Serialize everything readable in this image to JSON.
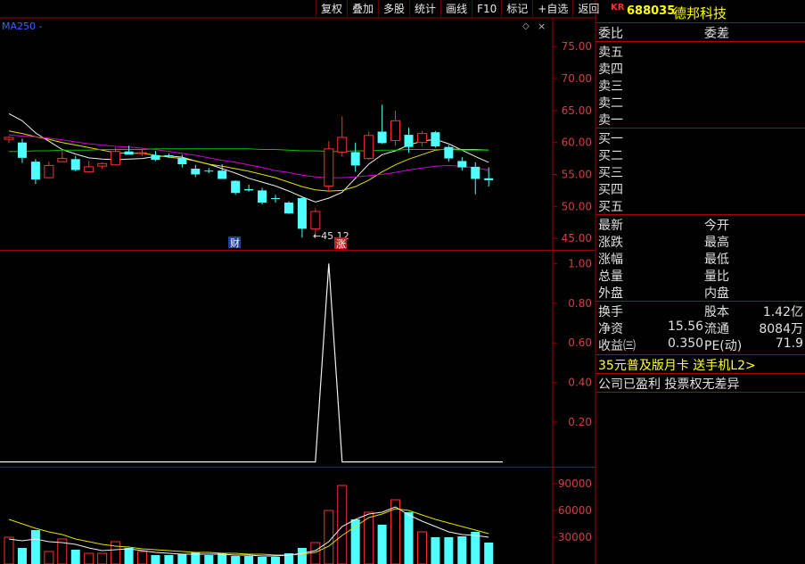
{
  "toolbar": {
    "buttons": [
      "复权",
      "叠加",
      "多股",
      "统计",
      "画线",
      "F10",
      "标记",
      "+自选",
      "返回"
    ]
  },
  "chart_overlay": {
    "ma_label": "MA250 -",
    "low_marker": "←45.12",
    "fin_badge": "财",
    "up_badge": "涨"
  },
  "header": {
    "market_tag": "KR",
    "code": "688035",
    "name": "德邦科技"
  },
  "quote": {
    "weibi_label": "委比",
    "weicha_label": "委差",
    "sell_levels": [
      "卖五",
      "卖四",
      "卖三",
      "卖二",
      "卖一"
    ],
    "buy_levels": [
      "买一",
      "买二",
      "买三",
      "买四",
      "买五"
    ],
    "fields": {
      "latest": "最新",
      "open_today": "今开",
      "change": "涨跌",
      "high": "最高",
      "change_pct": "涨幅",
      "low": "最低",
      "total_vol": "总量",
      "vol_ratio": "量比",
      "outer": "外盘",
      "inner": "内盘"
    },
    "stats": {
      "turnover_label": "换手",
      "equity_label": "股本",
      "equity_value": "1.42亿",
      "nav_label": "净资",
      "nav_value": "15.56",
      "float_label": "流通",
      "float_value": "8084万",
      "eps_label": "收益㈢",
      "eps_value": "0.350",
      "pe_label": "PE(动)",
      "pe_value": "71.9"
    },
    "ad_text": "35元普及版月卡 送手机L2>",
    "note_text": "公司已盈利 投票权无差异"
  },
  "chart_data": {
    "type": "candlestick",
    "price_axis": {
      "ticks": [
        "75.00",
        "70.00",
        "65.00",
        "60.00",
        "55.00",
        "50.00",
        "45.00"
      ],
      "ylim": [
        43.2,
        79.5
      ]
    },
    "indicator_axis": {
      "ticks": [
        "1.00",
        "0.80",
        "0.60",
        "0.40",
        "0.20"
      ],
      "ylim": [
        -0.02,
        1.06
      ]
    },
    "volume_axis": {
      "ticks": [
        "90000",
        "60000",
        "30000"
      ],
      "ylim": [
        0,
        108000
      ]
    },
    "candles": [
      {
        "o": 60.5,
        "h": 61.0,
        "l": 59.9,
        "c": 60.8
      },
      {
        "o": 60.0,
        "h": 60.6,
        "l": 56.8,
        "c": 57.6
      },
      {
        "o": 57.0,
        "h": 57.4,
        "l": 53.5,
        "c": 54.2
      },
      {
        "o": 54.5,
        "h": 57.0,
        "l": 54.4,
        "c": 56.4
      },
      {
        "o": 57.0,
        "h": 58.9,
        "l": 56.9,
        "c": 57.5
      },
      {
        "o": 57.4,
        "h": 57.9,
        "l": 55.5,
        "c": 55.7
      },
      {
        "o": 55.4,
        "h": 57.1,
        "l": 55.3,
        "c": 56.2
      },
      {
        "o": 56.3,
        "h": 56.9,
        "l": 55.9,
        "c": 56.7
      },
      {
        "o": 56.5,
        "h": 59.2,
        "l": 56.4,
        "c": 58.6
      },
      {
        "o": 58.6,
        "h": 59.5,
        "l": 58.1,
        "c": 58.1
      },
      {
        "o": 58.3,
        "h": 59.0,
        "l": 57.9,
        "c": 58.4
      },
      {
        "o": 58.0,
        "h": 58.7,
        "l": 57.1,
        "c": 57.3
      },
      {
        "o": 58.0,
        "h": 58.3,
        "l": 57.6,
        "c": 57.9
      },
      {
        "o": 57.6,
        "h": 58.1,
        "l": 56.1,
        "c": 56.6
      },
      {
        "o": 55.9,
        "h": 56.5,
        "l": 54.6,
        "c": 55.0
      },
      {
        "o": 55.6,
        "h": 56.0,
        "l": 55.2,
        "c": 55.5
      },
      {
        "o": 55.6,
        "h": 56.6,
        "l": 54.3,
        "c": 54.3
      },
      {
        "o": 54.0,
        "h": 54.1,
        "l": 51.8,
        "c": 52.1
      },
      {
        "o": 52.7,
        "h": 53.4,
        "l": 52.3,
        "c": 52.5
      },
      {
        "o": 52.5,
        "h": 52.9,
        "l": 50.3,
        "c": 50.6
      },
      {
        "o": 51.3,
        "h": 51.8,
        "l": 50.6,
        "c": 51.2
      },
      {
        "o": 50.6,
        "h": 50.8,
        "l": 48.8,
        "c": 48.9
      },
      {
        "o": 51.3,
        "h": 51.6,
        "l": 45.1,
        "c": 46.5
      },
      {
        "o": 46.5,
        "h": 49.7,
        "l": 45.1,
        "c": 49.2
      },
      {
        "o": 53.2,
        "h": 60.2,
        "l": 52.3,
        "c": 59.0
      },
      {
        "o": 58.5,
        "h": 64.1,
        "l": 57.8,
        "c": 60.8
      },
      {
        "o": 58.5,
        "h": 60.0,
        "l": 55.4,
        "c": 56.4
      },
      {
        "o": 57.5,
        "h": 61.7,
        "l": 57.3,
        "c": 61.1
      },
      {
        "o": 61.7,
        "h": 65.9,
        "l": 59.8,
        "c": 59.9
      },
      {
        "o": 60.3,
        "h": 65.0,
        "l": 59.5,
        "c": 63.4
      },
      {
        "o": 61.2,
        "h": 62.3,
        "l": 58.4,
        "c": 59.3
      },
      {
        "o": 60.0,
        "h": 61.8,
        "l": 59.4,
        "c": 61.4
      },
      {
        "o": 61.6,
        "h": 61.8,
        "l": 59.2,
        "c": 59.4
      },
      {
        "o": 59.3,
        "h": 59.6,
        "l": 57.0,
        "c": 57.5
      },
      {
        "o": 57.1,
        "h": 57.7,
        "l": 55.6,
        "c": 56.1
      },
      {
        "o": 56.2,
        "h": 56.9,
        "l": 51.9,
        "c": 54.3
      },
      {
        "o": 54.4,
        "h": 56.1,
        "l": 53.1,
        "c": 54.1
      }
    ],
    "ma_lines": [
      {
        "color": "#f0f0f0",
        "values": [
          64.5,
          63.4,
          61.5,
          60.2,
          58.9,
          58.2,
          57.6,
          57.4,
          57.3,
          57.4,
          57.5,
          57.8,
          57.9,
          57.7,
          57.1,
          56.6,
          55.9,
          55.2,
          54.4,
          53.8,
          53.2,
          52.4,
          51.5,
          50.7,
          51.3,
          52.2,
          54.4,
          56.6,
          58.1,
          58.7,
          59.6,
          60.2,
          60.5,
          59.8,
          58.8,
          57.8,
          56.9
        ]
      },
      {
        "color": "#e0e000",
        "values": [
          61.8,
          61.4,
          60.9,
          60.5,
          60.0,
          59.6,
          59.2,
          58.8,
          58.4,
          58.3,
          58.3,
          58.0,
          57.7,
          57.5,
          57.1,
          56.6,
          56.3,
          55.9,
          55.5,
          55.0,
          54.5,
          53.8,
          53.1,
          52.6,
          52.4,
          52.5,
          53.1,
          54.1,
          55.4,
          56.5,
          57.4,
          58.1,
          58.8,
          59.0,
          58.9,
          58.9,
          58.8
        ]
      },
      {
        "color": "#d000d0",
        "values": [
          61.2,
          61.0,
          60.9,
          60.7,
          60.4,
          60.1,
          59.8,
          59.6,
          59.4,
          59.3,
          59.1,
          58.9,
          58.6,
          58.3,
          58.0,
          57.6,
          57.2,
          56.9,
          56.5,
          56.1,
          55.6,
          55.3,
          54.9,
          54.6,
          54.5,
          54.5,
          54.6,
          54.8,
          55.0,
          55.3,
          55.7,
          56.0,
          56.3,
          56.4,
          56.3,
          56.0,
          55.7
        ]
      },
      {
        "color": "#00c000",
        "values": [
          58.6,
          58.6,
          58.7,
          58.7,
          58.8,
          58.8,
          58.8,
          58.9,
          58.9,
          58.9,
          58.9,
          59.0,
          59.0,
          59.0,
          59.0,
          59.0,
          59.0,
          59.0,
          59.0,
          58.9,
          58.9,
          58.8,
          58.7,
          58.7,
          58.6,
          58.6,
          58.7,
          58.7,
          58.8,
          58.8,
          58.9,
          58.9,
          58.9,
          58.9,
          58.8,
          58.8,
          58.8
        ]
      }
    ],
    "indicator": [
      0,
      0,
      0,
      0,
      0,
      0,
      0,
      0,
      0,
      0,
      0,
      0,
      0,
      0,
      0,
      0,
      0,
      0,
      0,
      0,
      0,
      0,
      0,
      0,
      1,
      0,
      0,
      0,
      0,
      0,
      0,
      0,
      0,
      0,
      0,
      0,
      0
    ],
    "volume": [
      30000,
      18000,
      38000,
      14000,
      28000,
      16000,
      12000,
      12000,
      25000,
      18000,
      14000,
      10000,
      10000,
      11000,
      13000,
      10000,
      12000,
      9000,
      9000,
      8000,
      8000,
      12000,
      18000,
      24000,
      60000,
      88000,
      50000,
      58000,
      44000,
      72000,
      58000,
      36000,
      30000,
      30000,
      31000,
      36000,
      24000
    ],
    "vol_ma": [
      {
        "color": "#e0e000",
        "values": [
          50000,
          45000,
          40000,
          36000,
          33000,
          28000,
          25000,
          22000,
          20000,
          19000,
          17000,
          16000,
          15000,
          14000,
          13000,
          13000,
          12000,
          12000,
          11000,
          11000,
          10000,
          10000,
          11000,
          13000,
          20000,
          32000,
          42000,
          52000,
          56000,
          62000,
          60000,
          55000,
          50000,
          46000,
          42000,
          38000,
          34000
        ]
      },
      {
        "color": "#f0f0f0",
        "values": [
          28000,
          26000,
          28000,
          25000,
          24000,
          22000,
          18000,
          15000,
          16000,
          17000,
          15000,
          13000,
          12000,
          11000,
          11000,
          11000,
          11000,
          10000,
          10000,
          9000,
          9000,
          10000,
          12000,
          15000,
          25000,
          42000,
          50000,
          56000,
          58000,
          64000,
          55000,
          48000,
          42000,
          36000,
          33000,
          32000,
          30000
        ]
      }
    ]
  }
}
